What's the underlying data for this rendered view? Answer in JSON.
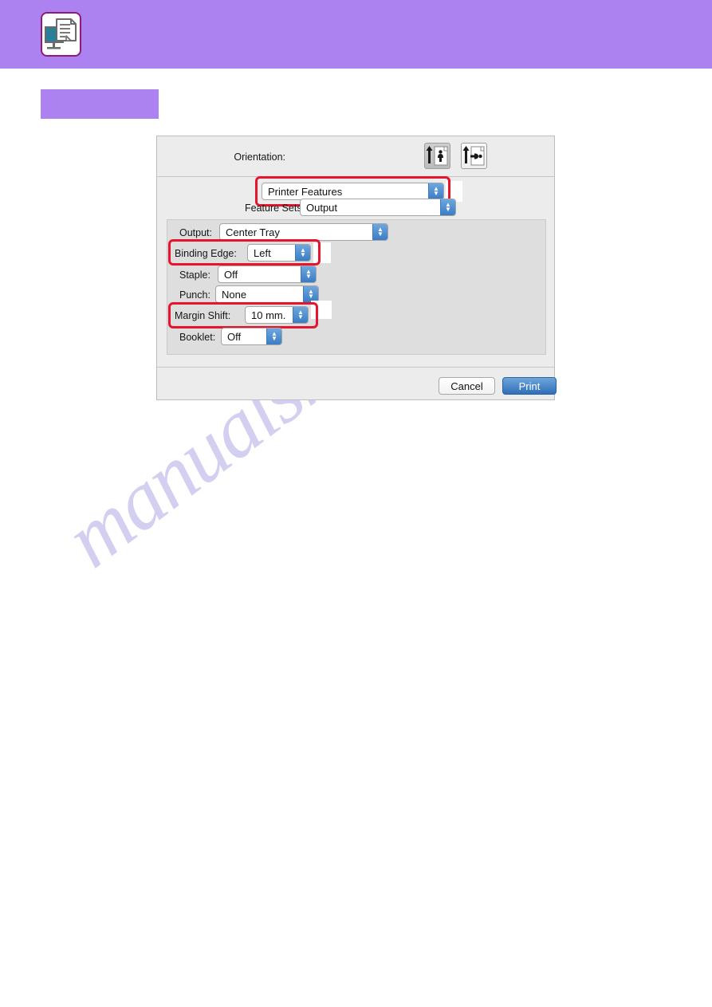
{
  "header": {
    "band_color": "#ab82ef",
    "icon_name": "network-printer-document-icon"
  },
  "section_title_block": {
    "color": "#ab82ef",
    "label": ""
  },
  "watermark": {
    "text": "manualshive.com"
  },
  "dialog": {
    "orientation": {
      "label": "Orientation:",
      "options": [
        {
          "name": "portrait",
          "selected": true
        },
        {
          "name": "landscape",
          "selected": false
        }
      ]
    },
    "panes_popup": {
      "value": "Printer Features",
      "highlighted": true
    },
    "feature_sets": {
      "label": "Feature Sets:",
      "value": "Output"
    },
    "settings": [
      {
        "label": "Output:",
        "value": "Center Tray",
        "highlighted": false
      },
      {
        "label": "Binding Edge:",
        "value": "Left",
        "highlighted": true
      },
      {
        "label": "Staple:",
        "value": "Off",
        "highlighted": false
      },
      {
        "label": "Punch:",
        "value": "None",
        "highlighted": false
      },
      {
        "label": "Margin Shift:",
        "value": "10 mm.",
        "highlighted": true
      },
      {
        "label": "Booklet:",
        "value": "Off",
        "highlighted": false
      }
    ],
    "buttons": {
      "cancel": "Cancel",
      "print": "Print"
    },
    "highlight_color": "#e8142d",
    "accent_color": "#3a7cc4"
  }
}
